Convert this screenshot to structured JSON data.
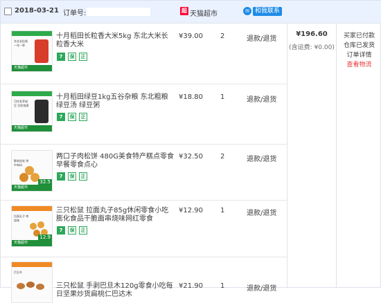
{
  "header": {
    "date": "2018-03-21",
    "order_label": "订单号: 1",
    "shop_logo": "超",
    "shop_name": "天猫超市",
    "contact_label": "和我联系"
  },
  "items": [
    {
      "title": "十月稻田长粒香大米5kg 东北大米长粒香大米",
      "thumb_text": "东北长粒香 一年一季",
      "thumb_footer": "天猫超市",
      "thumb_price": "",
      "unit_price": "¥39.00",
      "quantity": "2",
      "refund": "退款/退货"
    },
    {
      "title": "十月稻田绿豆1kg五谷杂粮 东北粗粮绿豆汤 绿豆粥",
      "thumb_text": "可作发芽绿豆 豆粒饱满",
      "thumb_footer": "天猫超市",
      "thumb_price": "",
      "unit_price": "¥18.80",
      "quantity": "1",
      "refund": "退款/退货"
    },
    {
      "title": "两口子肉松饼 480G美食特产糕点零食早餐零食点心",
      "thumb_text": "酥软松软 饼中有料",
      "thumb_footer": "天猫超市",
      "thumb_price": "32.5",
      "unit_price": "¥32.50",
      "quantity": "2",
      "refund": "退款/退货"
    },
    {
      "title": "三只松鼠 拉面丸子85g休闲零食小吃膨化食品干脆面串烧味网红零食",
      "thumb_text": "拉面丸子 串烧味",
      "thumb_footer": "天猫超市",
      "thumb_price": "12.9",
      "unit_price": "¥12.90",
      "quantity": "1",
      "refund": "退款/退货"
    },
    {
      "title": "三只松鼠 手剥巴旦木120g零食小吃每日坚果炒货扁桃仁巴达木",
      "thumb_text": "巴旦木",
      "thumb_footer": "天猫超市",
      "thumb_price": "",
      "unit_price": "¥21.90",
      "quantity": "1",
      "refund": "退款/退货"
    }
  ],
  "badges": {
    "seven_day": "7",
    "guarantee": "保",
    "genuine": "正"
  },
  "summary": {
    "total": "¥196.60",
    "shipping": "(含运费: ¥0.00)"
  },
  "status": {
    "line1": "买家已付款",
    "line2": "仓库已发货",
    "detail_label": "订单详情",
    "logistics_label": "查看物流"
  },
  "colors": {
    "header_bg": "#eaf1ff",
    "tmall_red": "#ff0036",
    "link_red": "#e4393c",
    "badge_green": "#2ea85b",
    "contact_blue": "#1e8ce6"
  }
}
